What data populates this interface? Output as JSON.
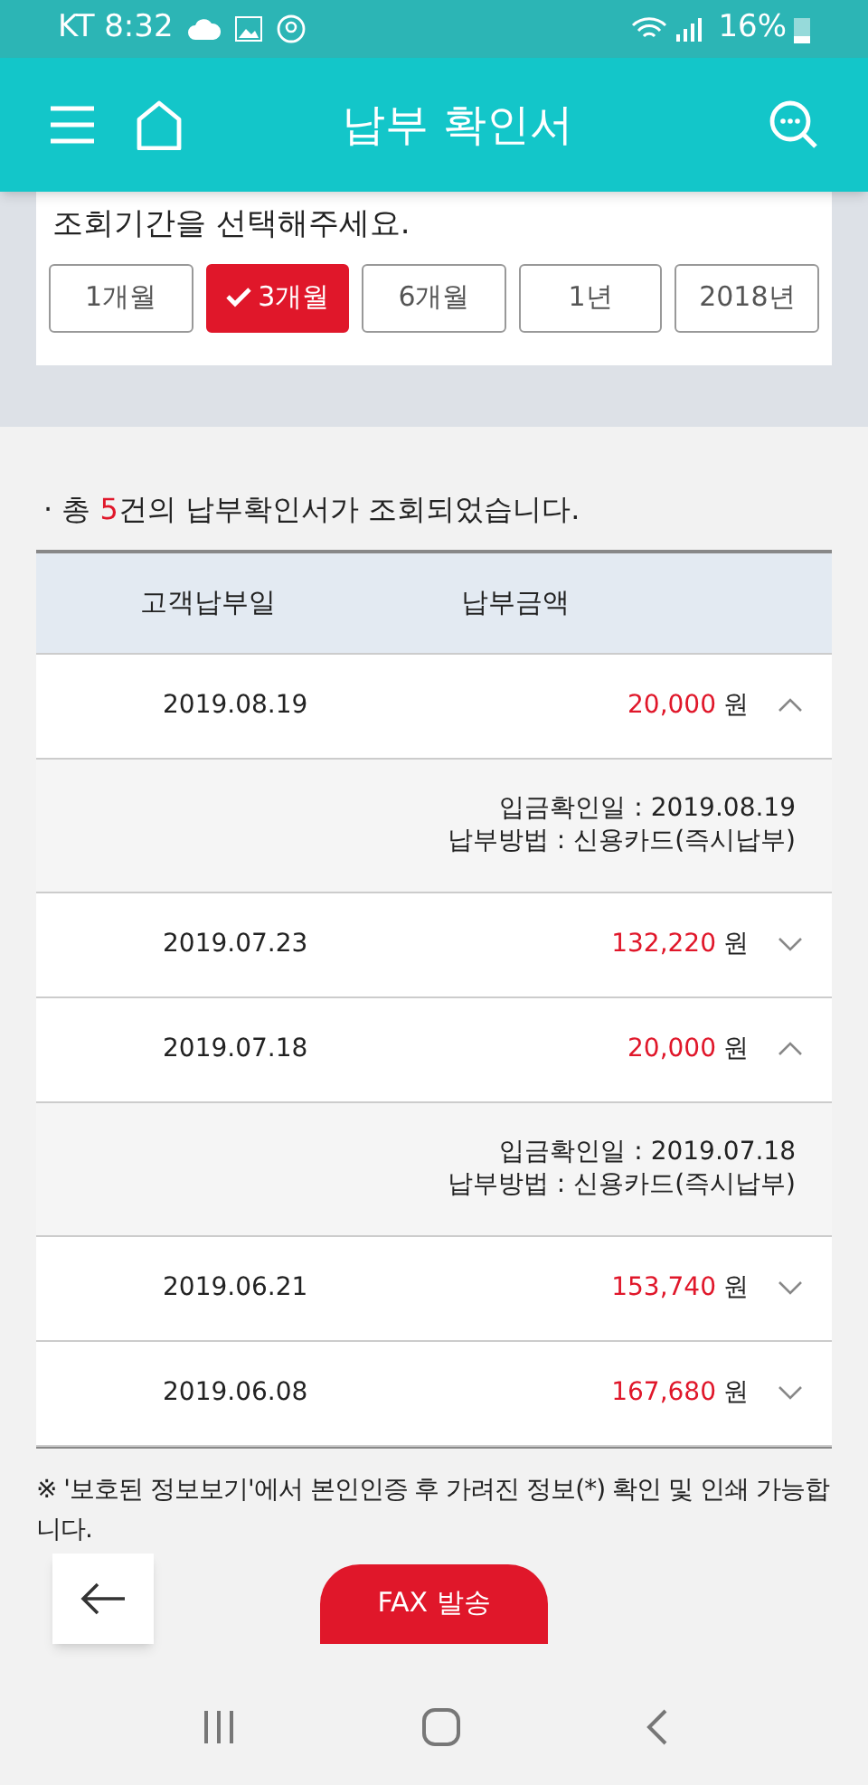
{
  "status_bar": {
    "carrier_time": "KT 8:32",
    "battery": "16%"
  },
  "header": {
    "title": "납부 확인서"
  },
  "period": {
    "prompt": "조회기간을 선택해주세요.",
    "options": [
      {
        "label": "1개월",
        "selected": false
      },
      {
        "label": "3개월",
        "selected": true
      },
      {
        "label": "6개월",
        "selected": false
      },
      {
        "label": "1년",
        "selected": false
      },
      {
        "label": "2018년",
        "selected": false
      }
    ]
  },
  "summary": {
    "bullet": "·",
    "prefix": "총 ",
    "count": "5",
    "suffix": "건의 납부확인서가 조회되었습니다."
  },
  "table": {
    "columns": [
      "고객납부일",
      "납부금액"
    ],
    "rows": [
      {
        "date": "2019.08.19",
        "amount": "20,000",
        "unit": "원",
        "expanded": true,
        "details": [
          "입금확인일 : 2019.08.19",
          "납부방법 : 신용카드(즉시납부)"
        ]
      },
      {
        "date": "2019.07.23",
        "amount": "132,220",
        "unit": "원",
        "expanded": false
      },
      {
        "date": "2019.07.18",
        "amount": "20,000",
        "unit": "원",
        "expanded": true,
        "details": [
          "입금확인일 : 2019.07.18",
          "납부방법 : 신용카드(즉시납부)"
        ]
      },
      {
        "date": "2019.06.21",
        "amount": "153,740",
        "unit": "원",
        "expanded": false
      },
      {
        "date": "2019.06.08",
        "amount": "167,680",
        "unit": "원",
        "expanded": false
      }
    ]
  },
  "notice": "※ '보호된 정보보기'에서 본인인증 후 가려진 정보(*) 확인 및 인쇄 가능합니다.",
  "fax_button": "FAX 발송"
}
